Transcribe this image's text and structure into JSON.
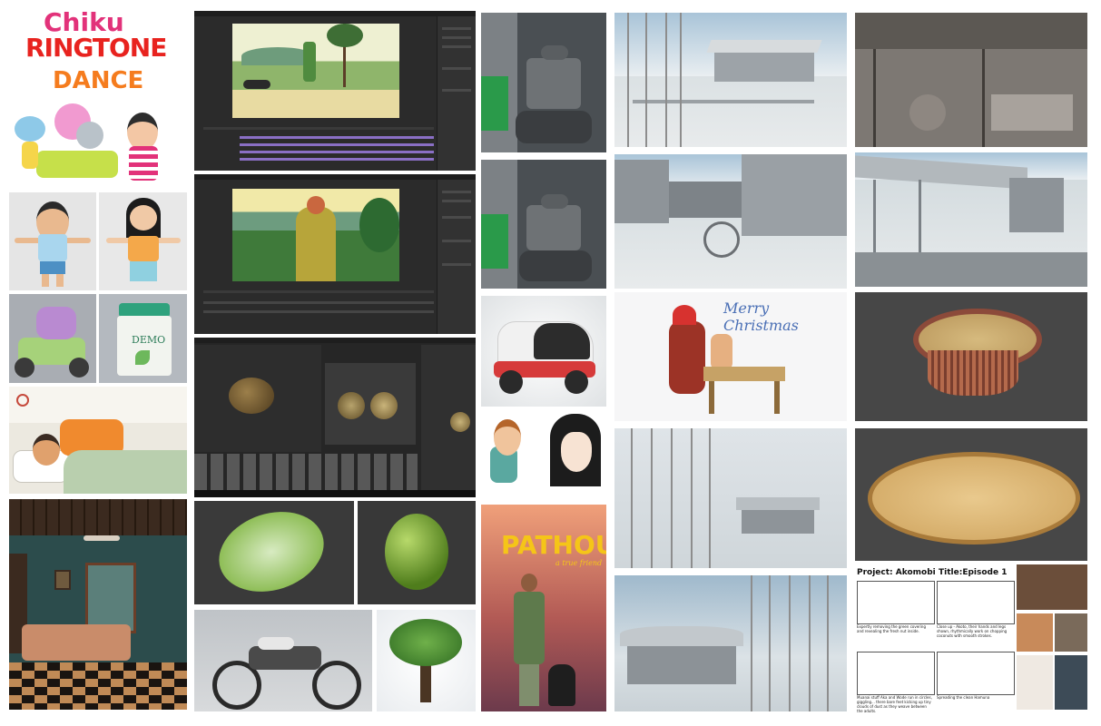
{
  "collage": {
    "chiku": {
      "line1": "Chiku",
      "line2": "RINGTONE",
      "line3": "DANCE"
    },
    "jar_label": "DEMO",
    "christmas_text": "Merry Christmas",
    "poster": {
      "title": "PATHOU",
      "subtitle": "a true friend"
    },
    "storyboard": {
      "project": "Project: Akomobi",
      "title": "Title:Episode 1",
      "caption1": "Expertly removing the green covering and revealing the fresh nut inside.",
      "caption2": "Close up - Akoto, their hands and legs shown, rhythmically work on chopping coconuts with smooth strokes.",
      "caption3": "Muanai stuff Aka and Wode run in circles, giggling... there bare feet kicking up tiny clouds of dust as they weave between the adults.",
      "caption4": "Spreading the clean Hamuna"
    },
    "colors": {
      "chiku_pink": "#e2327a",
      "chiku_orange": "#f57c1e",
      "ringtone_red": "#e8231f",
      "poster_yellow": "#f5c518",
      "christmas_blue": "#4a6fb5"
    }
  }
}
